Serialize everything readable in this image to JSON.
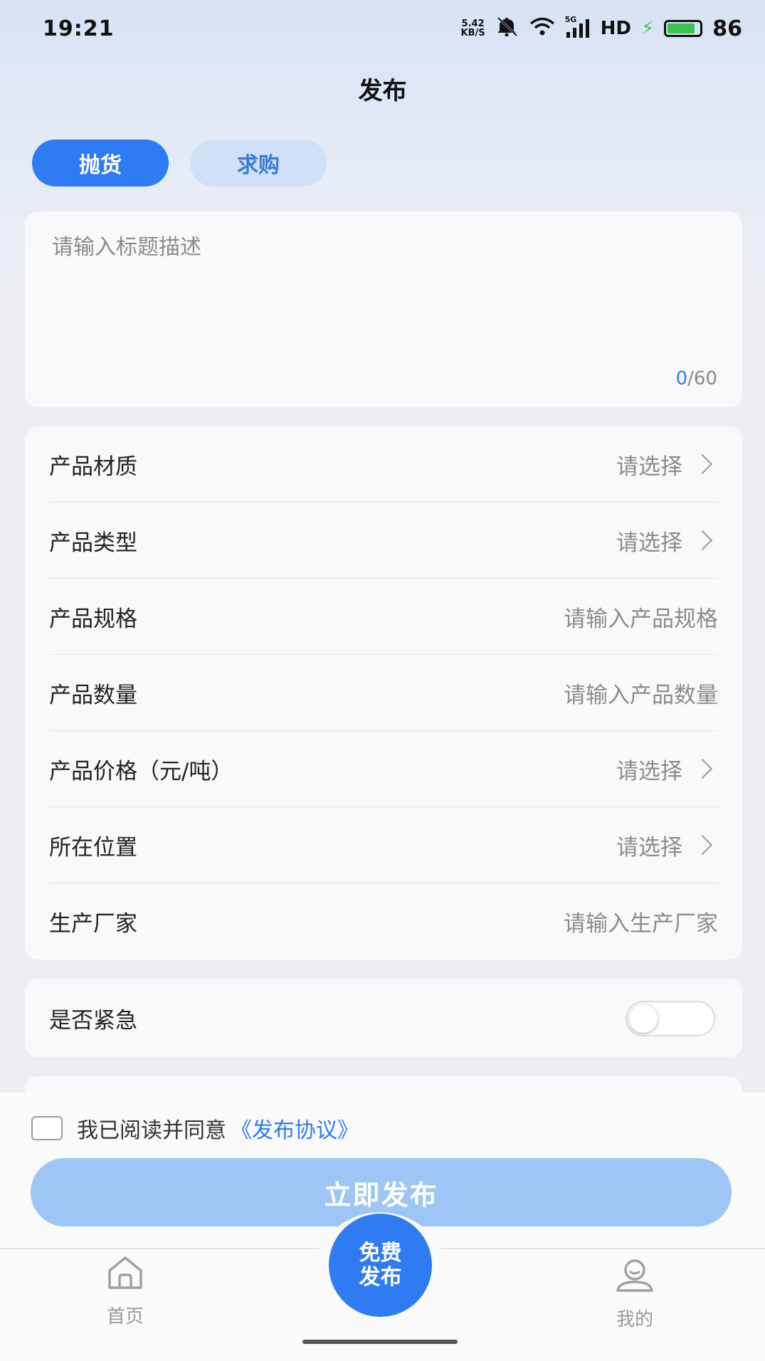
{
  "status_bar": {
    "time": "19:21",
    "net_speed_value": "5.42",
    "net_speed_unit": "KB/S",
    "network": "5G",
    "hd": "HD",
    "battery": "86",
    "battery_level": 0.86
  },
  "header": {
    "title": "发布"
  },
  "tabs": [
    {
      "label": "抛货",
      "active": true
    },
    {
      "label": "求购",
      "active": false
    }
  ],
  "title_input": {
    "placeholder": "请输入标题描述",
    "current_count": "0",
    "max_count": "/60"
  },
  "form": {
    "rows": [
      {
        "label": "产品材质",
        "value": "请选择"
      },
      {
        "label": "产品类型",
        "value": "请选择"
      },
      {
        "label": "产品规格",
        "value": "请输入产品规格"
      },
      {
        "label": "产品数量",
        "value": "请输入产品数量"
      },
      {
        "label": "产品价格（元/吨）",
        "value": "请选择"
      },
      {
        "label": "所在位置",
        "value": "请选择"
      },
      {
        "label": "生产厂家",
        "value": "请输入生产厂家"
      }
    ]
  },
  "urgent": {
    "label": "是否紧急",
    "enabled": false
  },
  "agreement": {
    "text": "我已阅读并同意",
    "link": "《发布协议》"
  },
  "publish_button": {
    "label": "立即发布"
  },
  "bottom_nav": {
    "home": "首页",
    "center_line1": "免费",
    "center_line2": "发布",
    "mine": "我的"
  },
  "colors": {
    "primary": "#2f7cf2",
    "primary_light": "#9dc6f6",
    "tab_inactive": "#cfe0f7"
  }
}
